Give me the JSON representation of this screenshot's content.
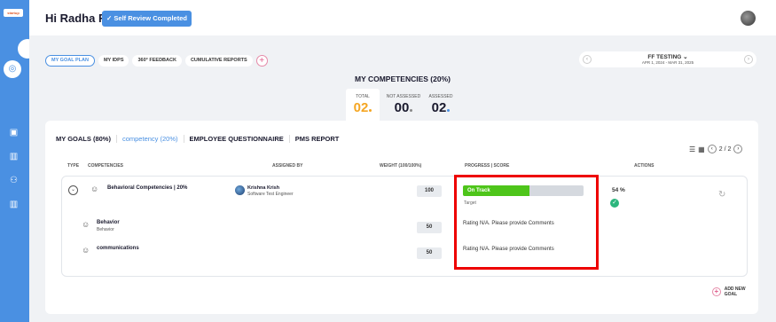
{
  "rail": {
    "logo": "startup",
    "items": [
      "home-icon",
      "book-icon",
      "users-icon",
      "book-icon"
    ]
  },
  "header": {
    "greeting": "Hi Radha R",
    "self_review_label": "Self Review Completed"
  },
  "tabs": [
    {
      "label": "MY GOAL PLAN",
      "active": true
    },
    {
      "label": "MY IDPS",
      "active": false
    },
    {
      "label": "360° FEEDBACK",
      "active": false
    },
    {
      "label": "CUMULATIVE REPORTS",
      "active": false
    }
  ],
  "cycle": {
    "name": "FF TESTING",
    "dates": "APR 1, 2024 - MAR 31, 2025"
  },
  "competencies": {
    "title": "MY COMPETENCIES (20%)",
    "total_label": "TOTAL",
    "total_value": "02",
    "not_assessed_label": "NOT ASSESSED",
    "not_assessed_value": "00",
    "assessed_label": "ASSESSED",
    "assessed_value": "02"
  },
  "goal_tabs": [
    "MY GOALS (80%)",
    "competency (20%)",
    "EMPLOYEE QUESTIONNAIRE",
    "PMS REPORT"
  ],
  "pager": "2 / 2",
  "table": {
    "headers": {
      "type": "TYPE",
      "competencies": "COMPETENCIES",
      "assigned_by": "ASSIGNED BY",
      "weight": "WEIGHT (100/100%)",
      "progress": "PROGRESS | SCORE",
      "actions": "ACTIONS"
    },
    "parent": {
      "name": "Behavioral Competencies | 20%",
      "assignee_name": "Krishna Krish",
      "assignee_role": "Software Test Engineer",
      "weight": "100",
      "status": "On Track",
      "progress": 0.55,
      "target_label": "Target",
      "percent": "54 %"
    },
    "children": [
      {
        "name": "Behavior",
        "sub": "Behavior",
        "weight": "50",
        "score_text": "Rating N/A. Please provide Comments"
      },
      {
        "name": "communications",
        "sub": "",
        "weight": "50",
        "score_text": "Rating N/A. Please provide Comments"
      }
    ]
  },
  "add_goal_label": "ADD NEW GOAL",
  "colors": {
    "primary": "#4a90e2",
    "on_track": "#4ec51a",
    "total": "#f5a623",
    "highlight": "#ee0000"
  }
}
